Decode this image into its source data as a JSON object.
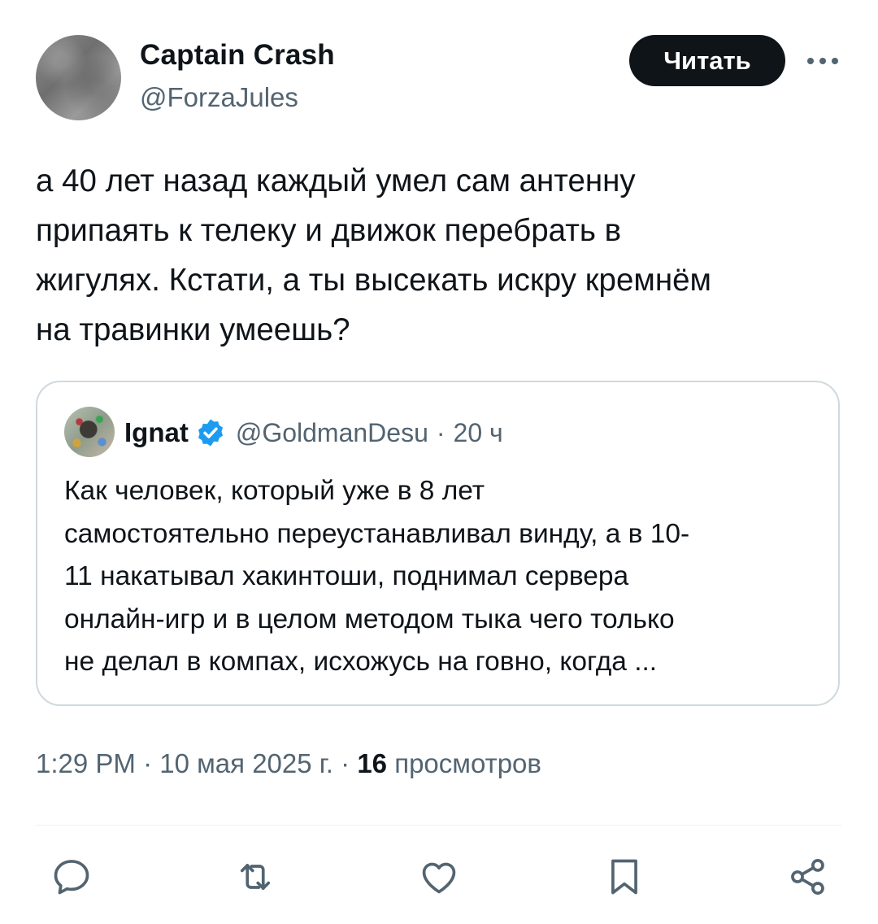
{
  "author": {
    "name": "Captain Crash",
    "handle": "@ForzaJules"
  },
  "follow_button": "Читать",
  "more_icon": "more-horizontal-icon",
  "tweet": {
    "text": "а 40 лет назад каждый умел сам антенну\nприпаять к телеку и движок перебрать в\nжигулях. Кстати, а ты высекать искру кремнём\nна травинки умеешь?"
  },
  "quoted": {
    "name": "Ignat",
    "verified": true,
    "handle": "@GoldmanDesu",
    "separator": "·",
    "time": "20 ч",
    "text": "Как человек, который уже в 8 лет\nсамостоятельно переустанавливал винду, а в 10-\n11 накатывал хакинтоши, поднимал сервера\nонлайн-игр и в целом методом тыка чего только\nне делал в компах, исхожусь на говно, когда ..."
  },
  "meta": {
    "time": "1:29 PM",
    "separator": "·",
    "date": "10 мая 2025 г.",
    "views_count": "16",
    "views_label": "просмотров"
  },
  "colors": {
    "text": "#0f1419",
    "secondary": "#536471",
    "border": "#cfd9de",
    "verified": "#1d9bf0",
    "button": "#0f1419"
  },
  "actions": [
    "reply-icon",
    "retweet-icon",
    "like-icon",
    "bookmark-icon",
    "share-icon"
  ]
}
